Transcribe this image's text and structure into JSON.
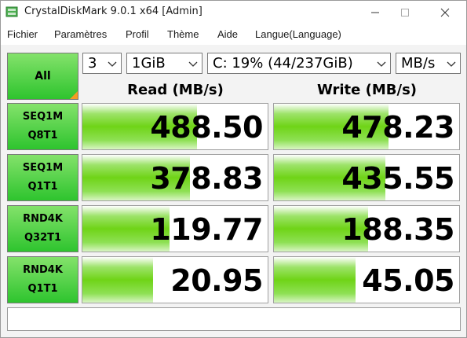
{
  "window": {
    "title": "CrystalDiskMark 9.0.1 x64 [Admin]",
    "controls": [
      "minimize-icon",
      "maximize-icon",
      "close-icon"
    ]
  },
  "menu": [
    "Fichier",
    "Paramètres",
    "Profil",
    "Thème",
    "Aide",
    "Langue(Language)"
  ],
  "controls": {
    "all_label": "All",
    "count": "3",
    "size": "1GiB",
    "drive": "C: 19% (44/237GiB)",
    "unit": "MB/s"
  },
  "headers": {
    "read": "Read (MB/s)",
    "write": "Write (MB/s)"
  },
  "tests": [
    {
      "line1": "SEQ1M",
      "line2": "Q8T1",
      "read": "488.50",
      "write": "478.23",
      "read_fill": 0.62,
      "write_fill": 0.62
    },
    {
      "line1": "SEQ1M",
      "line2": "Q1T1",
      "read": "378.83",
      "write": "435.55",
      "read_fill": 0.58,
      "write_fill": 0.6
    },
    {
      "line1": "RND4K",
      "line2": "Q32T1",
      "read": "119.77",
      "write": "188.35",
      "read_fill": 0.47,
      "write_fill": 0.51
    },
    {
      "line1": "RND4K",
      "line2": "Q1T1",
      "read": "20.95",
      "write": "45.05",
      "read_fill": 0.38,
      "write_fill": 0.44
    }
  ],
  "comment": "",
  "colors": {
    "button_green": "#2ec42e",
    "bar_green": "#6fd417",
    "corner_orange": "#f59a23"
  }
}
